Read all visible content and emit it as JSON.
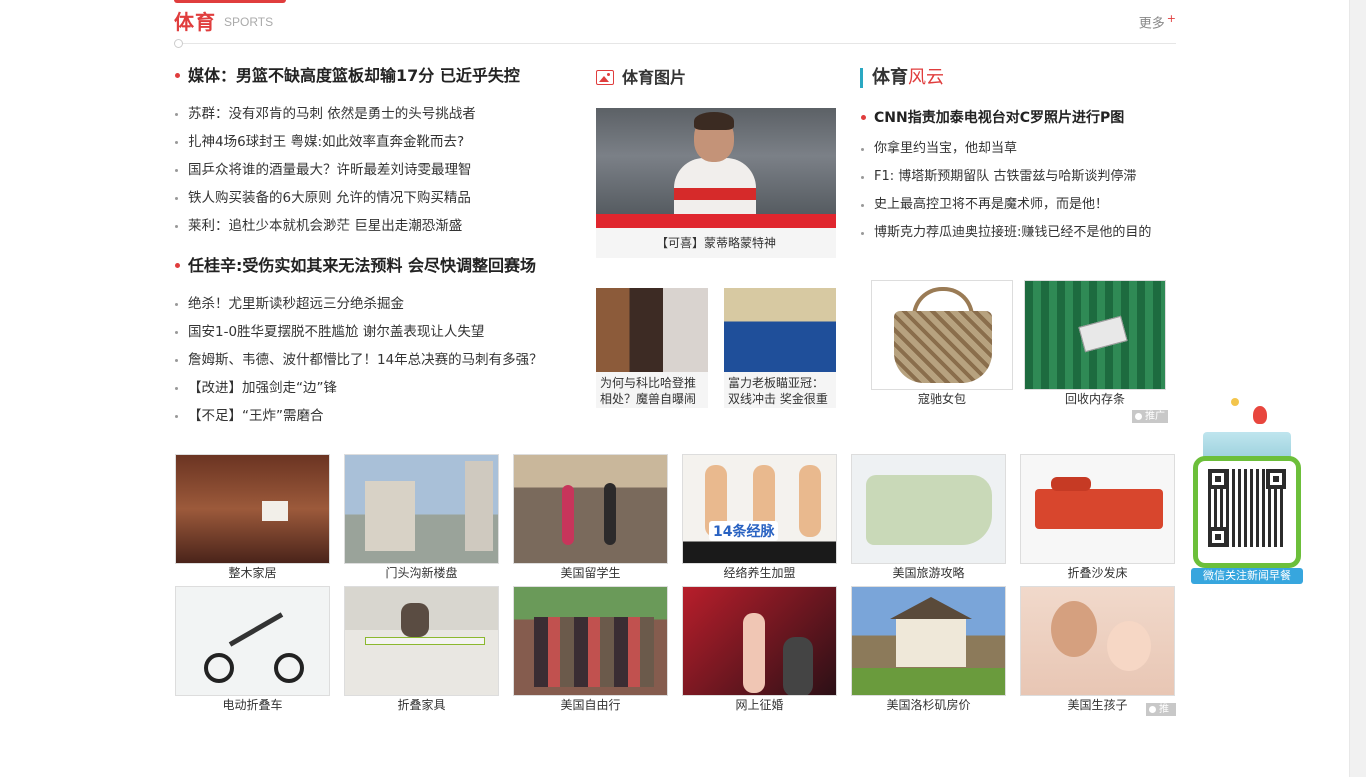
{
  "section": {
    "title": "体育",
    "subtitle": "SPORTS",
    "more_label": "更多",
    "more_plus": "+"
  },
  "news_groups": [
    {
      "headline": "媒体：男篮不缺高度篮板却输17分 已近乎失控",
      "items": [
        "苏群：没有邓肯的马刺 依然是勇士的头号挑战者",
        "扎神4场6球封王 粤媒:如此效率直奔金靴而去?",
        "国乒众将谁的酒量最大？许昕最差刘诗雯最理智",
        "铁人购买装备的6大原则 允许的情况下购买精品",
        "莱利：追杜少本就机会渺茫 巨星出走潮恐渐盛"
      ]
    },
    {
      "headline": "任桂辛:受伤实如其来无法预料 会尽快调整回赛场",
      "items": [
        "绝杀！尤里斯读秒超远三分绝杀掘金",
        "国安1-0胜华夏摆脱不胜尴尬 谢尔盖表现让人失望",
        "詹姆斯、韦德、波什都懵比了！14年总决赛的马刺有多强？",
        "【改进】加强剑走“边”锋",
        "【不足】“王炸”需磨合"
      ]
    }
  ],
  "photos": {
    "title": "体育图片",
    "main_caption": "【可喜】蒙蒂略蒙特神",
    "small": [
      {
        "caption": "为何与科比哈登推相处？魔兽自曝闹"
      },
      {
        "caption": "富力老板瞄亚冠：双线冲击 奖金很重"
      }
    ]
  },
  "fengyun": {
    "title_main": "体育",
    "title_accent": "风云",
    "headline": "CNN指责加泰电视台对C罗照片进行P图",
    "items": [
      "你拿里约当宝，他却当草",
      "F1: 博塔斯预期留队 古铁雷兹与哈斯谈判停滞",
      "史上最高控卫将不再是魔术师，而是他！",
      "博斯克力荐瓜迪奥拉接班:赚钱已经不是他的目的"
    ],
    "ads": [
      {
        "caption": "寇驰女包"
      },
      {
        "caption": "回收内存条"
      }
    ],
    "promo_label": "推广"
  },
  "grid": {
    "row1": [
      "整木家居",
      "门头沟新楼盘",
      "美国留学生",
      "经络养生加盟",
      "美国旅游攻略",
      "折叠沙发床"
    ],
    "row2": [
      "电动折叠车",
      "折叠家具",
      "美国自由行",
      "网上征婚",
      "美国洛杉矶房价",
      "美国生孩子"
    ],
    "promo_label": "推广",
    "overlay_text": "14条经脉"
  },
  "qr": {
    "label": "微信关注新闻早餐"
  }
}
